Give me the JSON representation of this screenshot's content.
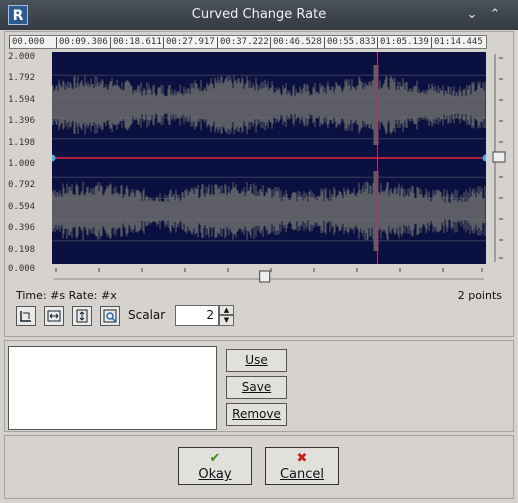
{
  "window": {
    "title": "Curved Change Rate",
    "app_icon": "R",
    "minimize_glyph": "⌄",
    "maximize_glyph": "⌃"
  },
  "ruler": {
    "ticks": [
      "00.000",
      "00:09.306",
      "00:18.611",
      "00:27.917",
      "00:37.222",
      "00:46.528",
      "00:55.833",
      "01:05.139",
      "01:14.445"
    ]
  },
  "y_axis": {
    "labels": [
      "2.000",
      "1.792",
      "1.594",
      "1.396",
      "1.198",
      "1.000",
      "0.792",
      "0.594",
      "0.396",
      "0.198",
      "0.000"
    ]
  },
  "curve": {
    "points": [
      [
        0,
        1.0
      ],
      [
        1,
        1.0
      ]
    ],
    "color": "#e8233f",
    "point_color": "#35b4f0"
  },
  "playhead": {
    "position_fraction": 0.75
  },
  "waveform": {
    "color": "#6c6c6c",
    "background": "#0a1140"
  },
  "h_slider_value": 0.49,
  "status": {
    "left": "Time: #s  Rate: #x",
    "right": "2 points"
  },
  "toolbar": {
    "icons": [
      "zoom-fit-icon",
      "fit-horizontal-icon",
      "fit-vertical-icon",
      "zoom-select-icon"
    ]
  },
  "scalar": {
    "label": "Scalar",
    "value": "2"
  },
  "presets": {
    "use": "Use",
    "save": "Save",
    "remove": "Remove"
  },
  "dialog": {
    "okay": "Okay",
    "cancel": "Cancel"
  }
}
